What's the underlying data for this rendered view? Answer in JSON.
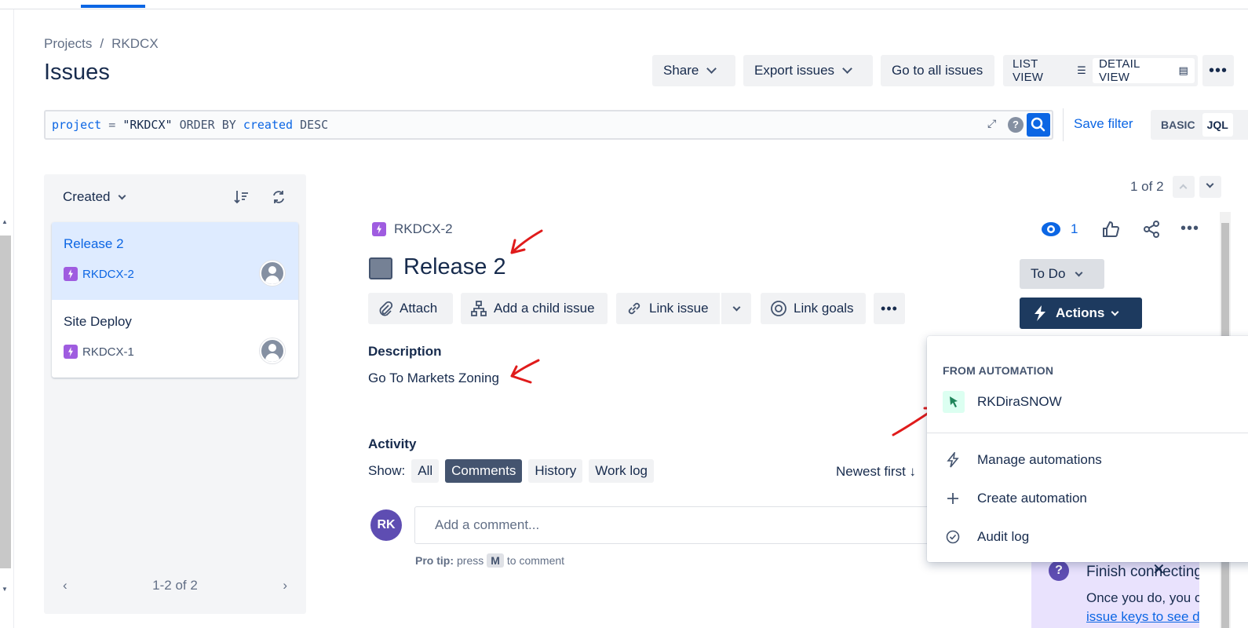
{
  "breadcrumb": [
    "Projects",
    "/",
    "RKDCX"
  ],
  "page_title": "Issues",
  "header_buttons": {
    "share": "Share",
    "export": "Export issues",
    "go_all": "Go to all issues"
  },
  "view_toggle": {
    "list": "LIST VIEW",
    "detail": "DETAIL VIEW"
  },
  "jql": {
    "project_kw": "project",
    "eq": "=",
    "value": "\"RKDCX\"",
    "order": "ORDER BY",
    "field": "created",
    "dir": "DESC"
  },
  "save_filter": "Save filter",
  "mode": {
    "basic": "BASIC",
    "jql": "JQL"
  },
  "list": {
    "sort_label": "Created",
    "items": [
      {
        "title": "Release 2",
        "key": "RKDCX-2",
        "selected": true
      },
      {
        "title": "Site Deploy",
        "key": "RKDCX-1",
        "selected": false
      }
    ],
    "pager": "1-2 of 2"
  },
  "position": "1 of 2",
  "issue": {
    "key": "RKDCX-2",
    "title": "Release 2",
    "watchers": "1",
    "buttons": {
      "attach": "Attach",
      "child": "Add a child issue",
      "link": "Link issue",
      "goals": "Link goals"
    },
    "description_label": "Description",
    "description": "Go To Markets Zoning",
    "status": "To Do",
    "actions": "Actions"
  },
  "activity": {
    "label": "Activity",
    "show": "Show:",
    "filters": [
      "All",
      "Comments",
      "History",
      "Work log"
    ],
    "active_filter": "Comments",
    "sort": "Newest first",
    "avatar_initials": "RK",
    "comment_placeholder": "Add a comment...",
    "protip_bold": "Pro tip:",
    "protip_pre": "press",
    "protip_key": "M",
    "protip_post": "to comment"
  },
  "menu": {
    "heading": "FROM AUTOMATION",
    "rule": "RKDiraSNOW",
    "manage": "Manage automations",
    "create": "Create automation",
    "audit": "Audit log"
  },
  "banner": {
    "title": "Finish connecting G",
    "body": "Once you do, you can",
    "link": "issue keys to see deve"
  },
  "colors": {
    "accent": "#0c66e4",
    "actions_bg": "#1d3a5f",
    "epic": "#9f5ce0",
    "annotation": "#e01b1b"
  }
}
